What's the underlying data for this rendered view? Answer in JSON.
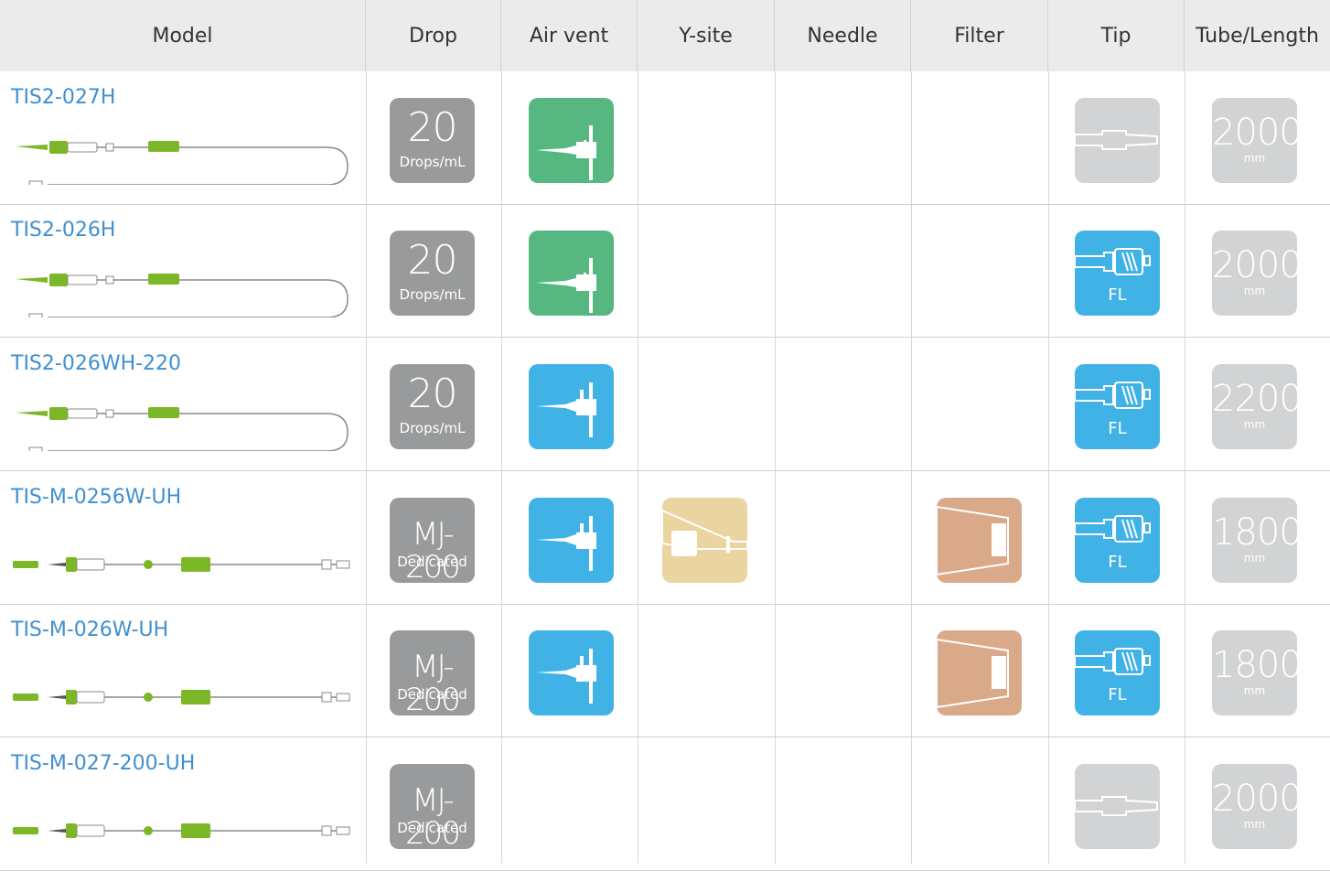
{
  "headers": {
    "model": "Model",
    "drop": "Drop",
    "air_vent": "Air vent",
    "y_site": "Y-site",
    "needle": "Needle",
    "filter": "Filter",
    "tip": "Tip",
    "tube_length": "Tube/Length"
  },
  "rows": [
    {
      "model": "TIS2-027H",
      "drop_value": "20",
      "drop_unit": "Drops/mL",
      "air_vent": "green",
      "y_site": false,
      "filter": false,
      "tip": "standard",
      "tip_label": "",
      "length": "2000",
      "length_unit": "mm"
    },
    {
      "model": "TIS2-026H",
      "drop_value": "20",
      "drop_unit": "Drops/mL",
      "air_vent": "green",
      "y_site": false,
      "filter": false,
      "tip": "luer-lock",
      "tip_label": "FL",
      "length": "2000",
      "length_unit": "mm"
    },
    {
      "model": "TIS2-026WH-220",
      "drop_value": "20",
      "drop_unit": "Drops/mL",
      "air_vent": "blue",
      "y_site": false,
      "filter": false,
      "tip": "luer-lock",
      "tip_label": "FL",
      "length": "2200",
      "length_unit": "mm"
    },
    {
      "model": "TIS-M-0256W-UH",
      "drop_value": "MJ-200",
      "drop_unit": "Dedicated",
      "air_vent": "blue",
      "y_site": true,
      "filter": true,
      "tip": "luer-lock",
      "tip_label": "FL",
      "length": "1800",
      "length_unit": "mm"
    },
    {
      "model": "TIS-M-026W-UH",
      "drop_value": "MJ-200",
      "drop_unit": "Dedicated",
      "air_vent": "blue",
      "y_site": false,
      "filter": true,
      "tip": "luer-lock",
      "tip_label": "FL",
      "length": "1800",
      "length_unit": "mm"
    },
    {
      "model": "TIS-M-027-200-UH",
      "drop_value": "MJ-200",
      "drop_unit": "Dedicated",
      "air_vent": "none",
      "y_site": false,
      "filter": false,
      "tip": "standard",
      "tip_label": "",
      "length": "2000",
      "length_unit": "mm"
    }
  ],
  "colors": {
    "header_bg": "#ebebeb",
    "model_text": "#3f8fd0",
    "drop_tile": "#999a9b",
    "length_tile": "#d2d3d4",
    "air_vent_green": "#56b880",
    "air_vent_blue": "#41b2e6",
    "y_site": "#ead49f",
    "filter": "#daa98a",
    "tip_fl": "#41b2e6",
    "tip_standard": "#d2d3d4",
    "tube_green": "#7cb728"
  },
  "icons": {
    "air_vent": "spike-needle-icon",
    "y_site": "y-site-icon",
    "filter": "filter-icon",
    "tip_standard": "slip-tip-icon",
    "tip_fl": "luer-lock-tip-icon",
    "tube": "infusion-set-drawing"
  }
}
